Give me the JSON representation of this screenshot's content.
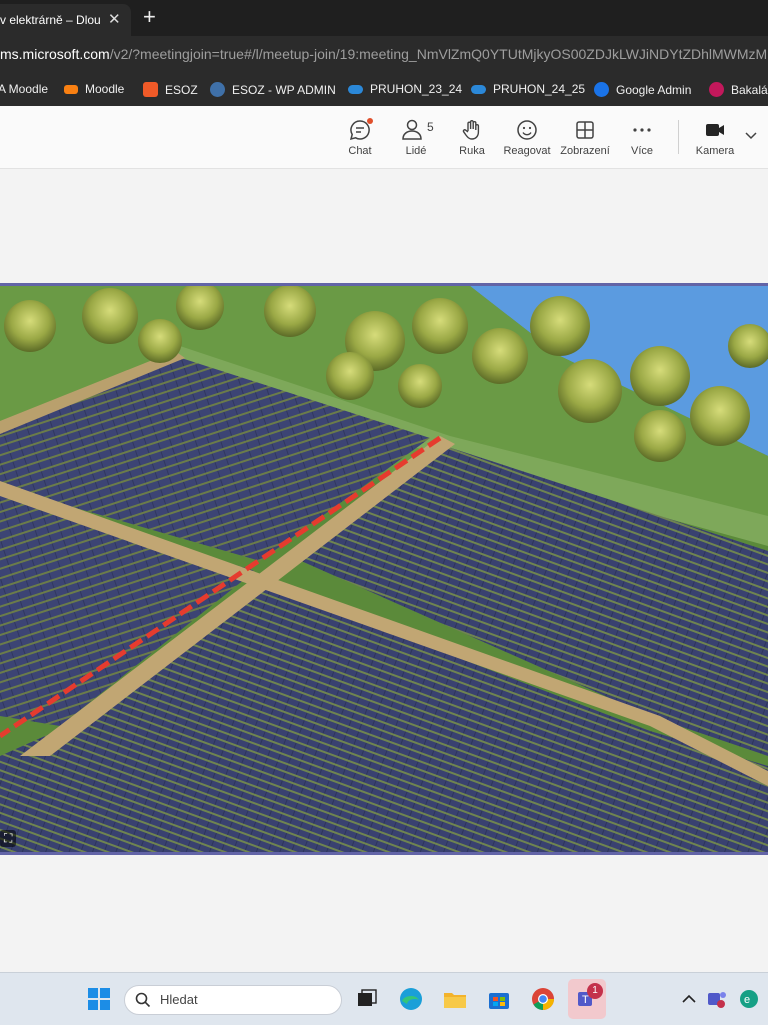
{
  "browser": {
    "tab_title": "v elektrárně – Dlouh",
    "url_prefix": "ms.microsoft.com",
    "url_rest": "/v2/?meetingjoin=true#/l/meetup-join/19:meeting_NmVlZmQ0YTUtMjkyOS00ZDJkLWJiNDYtZDhlMWMzM"
  },
  "bookmarks": [
    {
      "label": "A Moodle",
      "color": "#f98012"
    },
    {
      "label": "Moodle",
      "color": "#f98012"
    },
    {
      "label": "ESOZ",
      "color": "#f05a28"
    },
    {
      "label": "ESOZ - WP ADMIN",
      "color": "#3f70a8"
    },
    {
      "label": "PRUHON_23_24",
      "color": "#2b88d8"
    },
    {
      "label": "PRUHON_24_25",
      "color": "#2b88d8"
    },
    {
      "label": "Google Admin",
      "color": "#1a73e8"
    },
    {
      "label": "Bakalá",
      "color": "#c2185b"
    }
  ],
  "teams_toolbar": {
    "chat": "Chat",
    "people_count": "5",
    "people": "Lidé",
    "hand": "Ruka",
    "react": "Reagovat",
    "view": "Zobrazení",
    "more": "Více",
    "camera": "Kamera",
    "accent": "#6264a7"
  },
  "video": {
    "scene": "solar-farm-aerial",
    "sky_color": "#5b9be0",
    "grass_color": "#5a8a3c"
  },
  "taskbar": {
    "search_placeholder": "Hledat",
    "teams_badge": "1",
    "apps": [
      "windows-start-icon",
      "task-view-icon",
      "edge-icon",
      "file-explorer-icon",
      "store-icon",
      "chrome-icon",
      "teams-icon"
    ]
  }
}
